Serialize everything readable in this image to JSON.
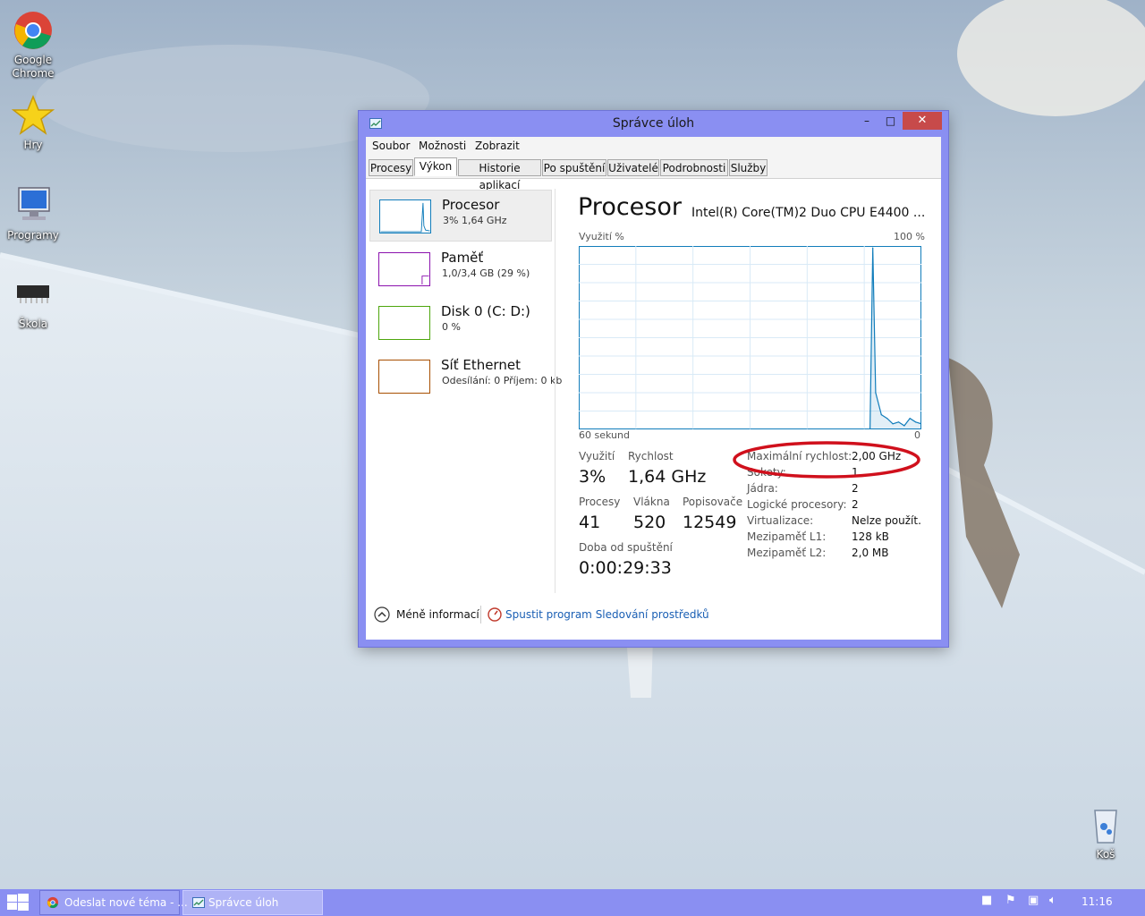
{
  "desktop": {
    "icons": [
      {
        "label": "Google\nChrome",
        "icon": "chrome-icon"
      },
      {
        "label": "Hry",
        "icon": "star-icon"
      },
      {
        "label": "Programy",
        "icon": "computer-icon"
      },
      {
        "label": "Škola",
        "icon": "chip-icon"
      },
      {
        "label": "Koš",
        "icon": "recycle-bin-icon"
      }
    ]
  },
  "window": {
    "title": "Správce úloh",
    "minimize": "–",
    "maximize": "□",
    "close": "✕",
    "menu": [
      "Soubor",
      "Možnosti",
      "Zobrazit"
    ],
    "tabs": [
      "Procesy",
      "Výkon",
      "Historie aplikací",
      "Po spuštění",
      "Uživatelé",
      "Podrobnosti",
      "Služby"
    ],
    "active_tab": "Výkon"
  },
  "sidebar": [
    {
      "title": "Procesor",
      "sub": "3%  1,64 GHz",
      "color": "#117dbb"
    },
    {
      "title": "Paměť",
      "sub": "1,0/3,4 GB (29 %)",
      "color": "#8b12ae"
    },
    {
      "title": "Disk 0 (C: D:)",
      "sub": "0 %",
      "color": "#4da60c"
    },
    {
      "title": "Síť Ethernet",
      "sub": "Odesílání: 0  Příjem: 0 kb",
      "color": "#a74f01"
    }
  ],
  "main": {
    "title": "Procesor",
    "cpu_name": "Intel(R) Core(TM)2 Duo CPU E4400 ...",
    "graph_top_left": "Využití %",
    "graph_top_right": "100 %",
    "graph_bottom_left": "60 sekund",
    "graph_bottom_right": "0",
    "stats": {
      "util_label": "Využití",
      "util_value": "3%",
      "speed_label": "Rychlost",
      "speed_value": "1,64 GHz",
      "proc_label": "Procesy",
      "proc_value": "41",
      "threads_label": "Vlákna",
      "threads_value": "520",
      "handles_label": "Popisovače",
      "handles_value": "12549",
      "uptime_label": "Doba od spuštění",
      "uptime_value": "0:00:29:33"
    },
    "specs": [
      {
        "k": "Maximální rychlost:",
        "v": "2,00 GHz"
      },
      {
        "k": "Sokety:",
        "v": "1"
      },
      {
        "k": "Jádra:",
        "v": "2"
      },
      {
        "k": "Logické procesory:",
        "v": "2"
      },
      {
        "k": "Virtualizace:",
        "v": "Nelze použít."
      },
      {
        "k": "Mezipaměť L1:",
        "v": "128 kB"
      },
      {
        "k": "Mezipaměť L2:",
        "v": "2,0 MB"
      }
    ]
  },
  "chart_data": {
    "type": "line",
    "x": [
      60,
      45,
      35,
      10,
      9,
      8.5,
      8,
      7,
      6,
      5,
      4,
      3,
      2,
      1,
      0
    ],
    "values": [
      0,
      0,
      0,
      0,
      0,
      99,
      20,
      8,
      6,
      3,
      4,
      2,
      6,
      4,
      3
    ],
    "xlabel": "60 sekund",
    "ylabel": "Využití %",
    "ylim": [
      0,
      100
    ],
    "grid": true,
    "color": "#117dbb"
  },
  "footer": {
    "less_info": "Méně informací",
    "resource_monitor": "Spustit program Sledování prostředků"
  },
  "taskbar": {
    "items": [
      "Odeslat nové téma - ...",
      "Správce úloh"
    ],
    "time": "11:16"
  },
  "annotation": {
    "color": "#d0101c"
  }
}
